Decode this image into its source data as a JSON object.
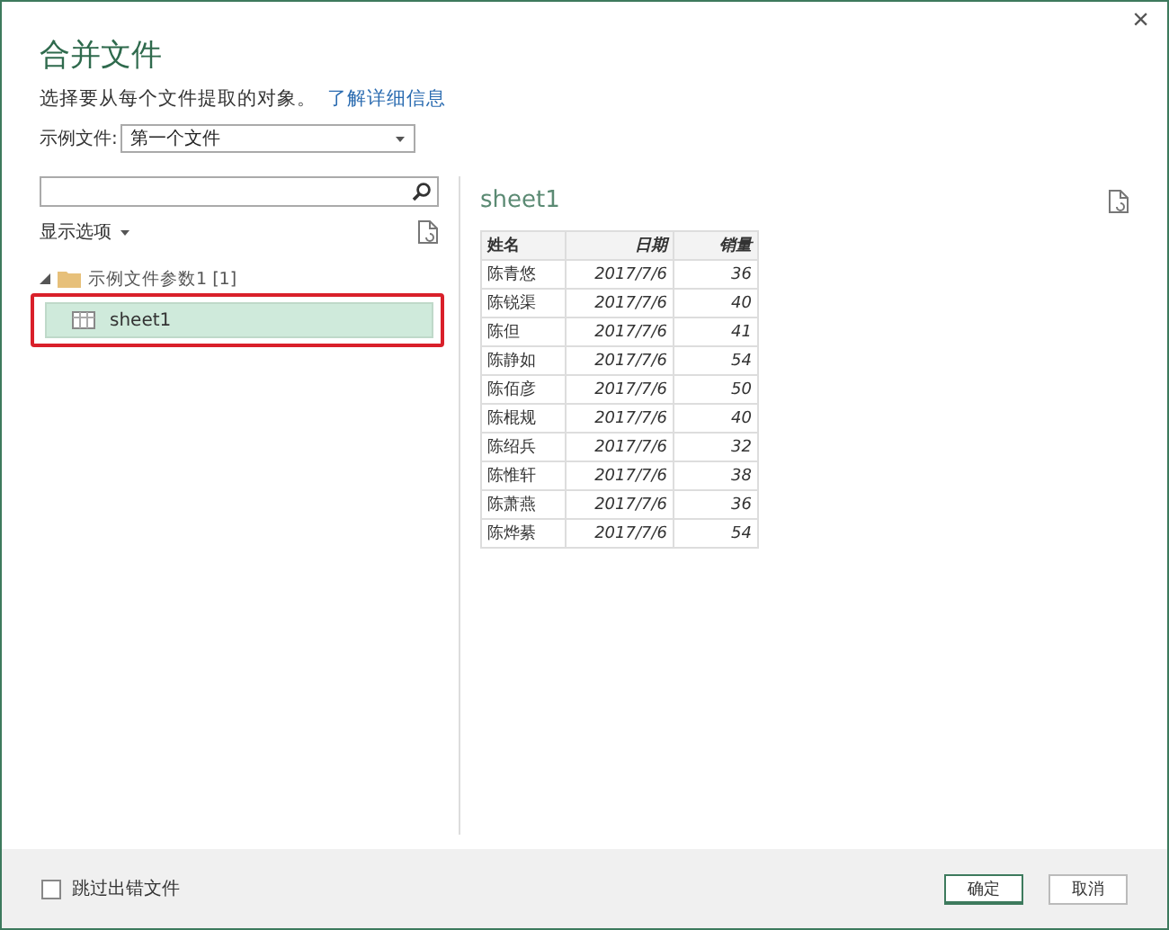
{
  "window": {
    "title": "合并文件",
    "close": "×"
  },
  "intro": {
    "text": "选择要从每个文件提取的对象。",
    "link": "了解详细信息"
  },
  "sample_file": {
    "label": "示例文件:",
    "value": "第一个文件"
  },
  "navigator": {
    "display_options": "显示选项",
    "tree": [
      {
        "label": "示例文件参数1 [1]",
        "kind": "folder",
        "expanded": true,
        "selected": false,
        "children": [
          {
            "label": "sheet1",
            "kind": "sheet",
            "selected": true
          }
        ]
      }
    ]
  },
  "preview": {
    "title": "sheet1",
    "table": {
      "columns": [
        "姓名",
        "日期",
        "销量"
      ],
      "rows": [
        [
          "陈青悠",
          "2017/7/6",
          "36"
        ],
        [
          "陈锐渠",
          "2017/7/6",
          "40"
        ],
        [
          "陈但",
          "2017/7/6",
          "41"
        ],
        [
          "陈静如",
          "2017/7/6",
          "54"
        ],
        [
          "陈佰彦",
          "2017/7/6",
          "50"
        ],
        [
          "陈棍规",
          "2017/7/6",
          "40"
        ],
        [
          "陈绍兵",
          "2017/7/6",
          "32"
        ],
        [
          "陈惟轩",
          "2017/7/6",
          "38"
        ],
        [
          "陈萧燕",
          "2017/7/6",
          "36"
        ],
        [
          "陈烨綦",
          "2017/7/6",
          "54"
        ]
      ]
    }
  },
  "footer": {
    "skip_errors": {
      "label": "跳过出错文件",
      "checked": false
    },
    "buttons": [
      {
        "label": "确定",
        "kind": "primary"
      },
      {
        "label": "取消",
        "kind": "secondary"
      }
    ]
  }
}
